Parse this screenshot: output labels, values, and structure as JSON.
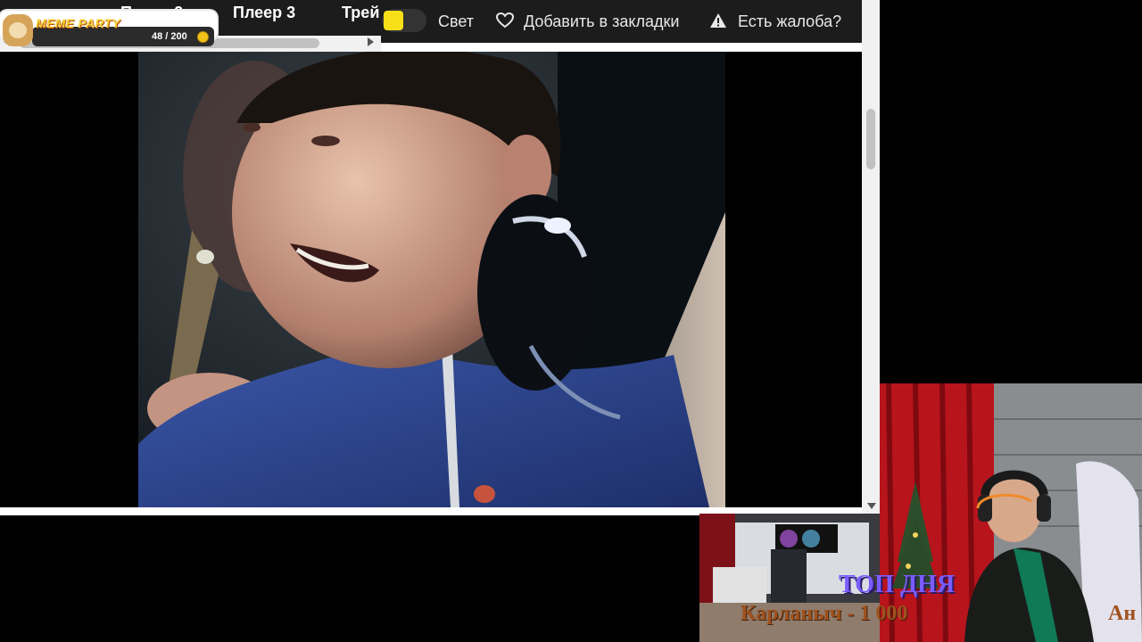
{
  "player_tabs": [
    {
      "label": "Плеер 2"
    },
    {
      "label": "Плеер 3"
    },
    {
      "label": "Трей"
    }
  ],
  "meme_party": {
    "title": "MEME PARTY",
    "progress_text": "48 / 200",
    "current": 48,
    "total": 200
  },
  "toolbar": {
    "light_label": "Свет",
    "bookmark_label": "Добавить в закладки",
    "report_label": "Есть жалоба?"
  },
  "stream_overlay": {
    "top_label": "ТОП ДНЯ",
    "top_entry": "Карланыч - 1 000",
    "right_fragment": "Ан"
  },
  "colors": {
    "toggle_knob": "#f7e017",
    "topbar_bg": "#1c1c1c",
    "overlay_purple": "#7a5cff",
    "overlay_brown": "#a0521f"
  },
  "icons": {
    "bookmark": "heart-icon",
    "report": "warning-icon",
    "meme": "doge-icon",
    "coin": "coin-icon"
  }
}
